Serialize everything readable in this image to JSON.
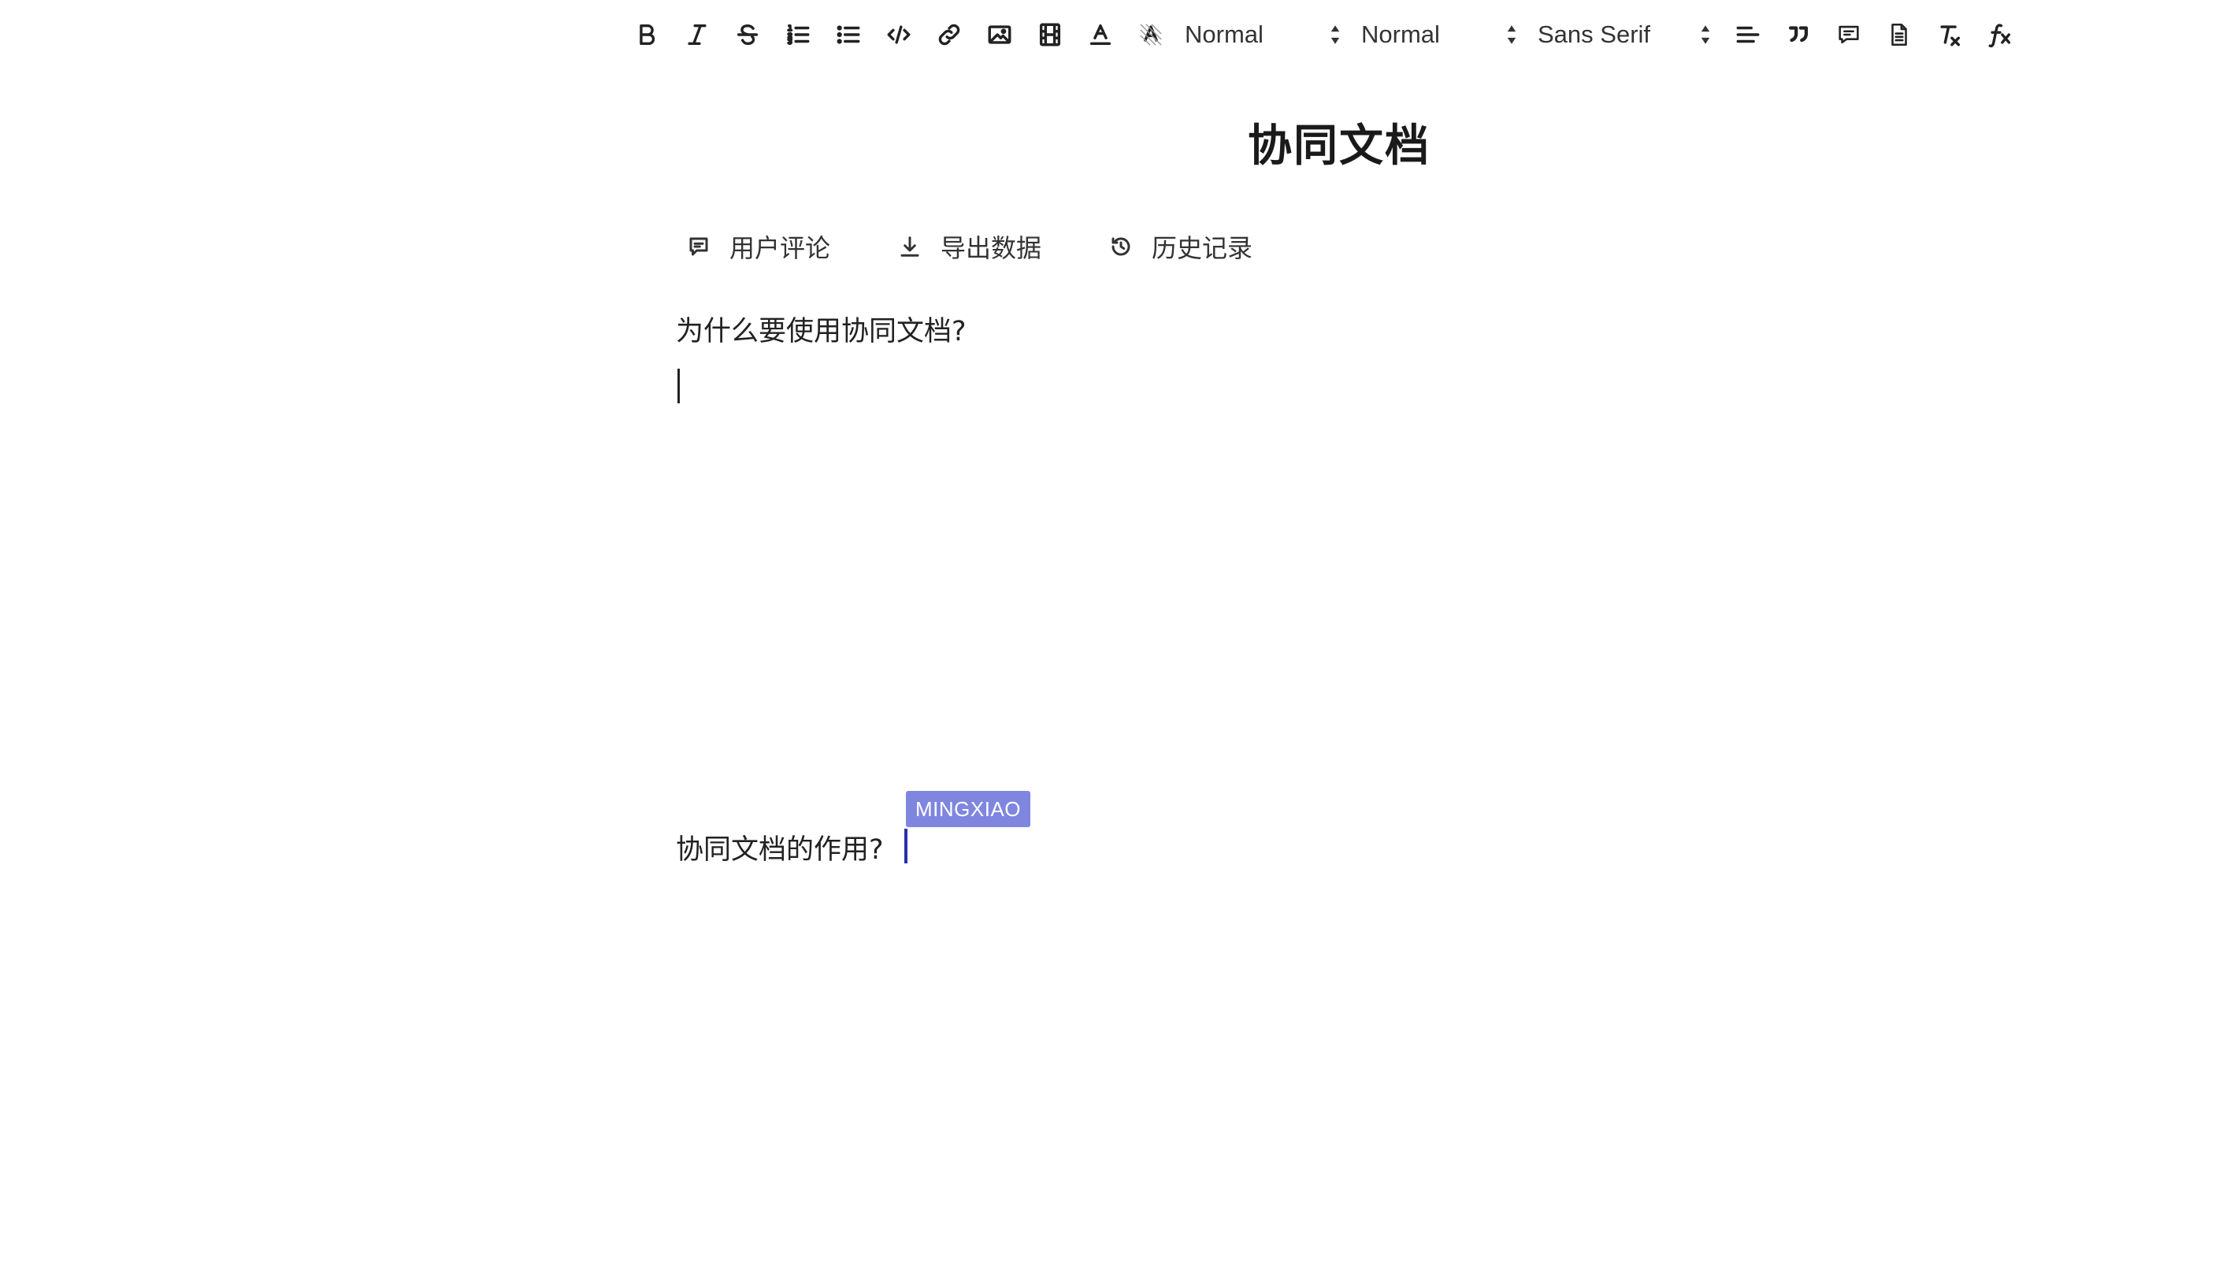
{
  "toolbar": {
    "buttons": [
      {
        "name": "bold-button",
        "icon": "bold-icon"
      },
      {
        "name": "italic-button",
        "icon": "italic-icon"
      },
      {
        "name": "strike-button",
        "icon": "strikethrough-icon"
      },
      {
        "name": "ordered-list-button",
        "icon": "ordered-list-icon"
      },
      {
        "name": "bullet-list-button",
        "icon": "bullet-list-icon"
      },
      {
        "name": "code-button",
        "icon": "code-icon"
      },
      {
        "name": "link-button",
        "icon": "link-icon"
      },
      {
        "name": "image-button",
        "icon": "image-icon"
      },
      {
        "name": "video-button",
        "icon": "video-icon"
      },
      {
        "name": "font-color-button",
        "icon": "font-color-icon"
      },
      {
        "name": "background-color-button",
        "icon": "highlight-icon"
      }
    ],
    "header_select": "Normal",
    "size_select": "Normal",
    "font_select": "Sans Serif",
    "trailing_buttons": [
      {
        "name": "align-button",
        "icon": "align-left-icon"
      },
      {
        "name": "blockquote-button",
        "icon": "quote-icon"
      },
      {
        "name": "comment-button",
        "icon": "comment-icon"
      },
      {
        "name": "document-button",
        "icon": "document-icon"
      },
      {
        "name": "clear-format-button",
        "icon": "clear-format-icon"
      },
      {
        "name": "formula-button",
        "icon": "formula-icon"
      }
    ]
  },
  "document": {
    "title": "协同文档"
  },
  "actions": {
    "comments": "用户评论",
    "export": "导出数据",
    "history": "历史记录"
  },
  "editor": {
    "para_1": "为什么要使用协同文档?",
    "para_3": "协同文档的作用?",
    "remote_user": "MINGXIAO"
  },
  "colors": {
    "remote_flag": "#7f86e0",
    "remote_caret": "#2a2fa8"
  }
}
